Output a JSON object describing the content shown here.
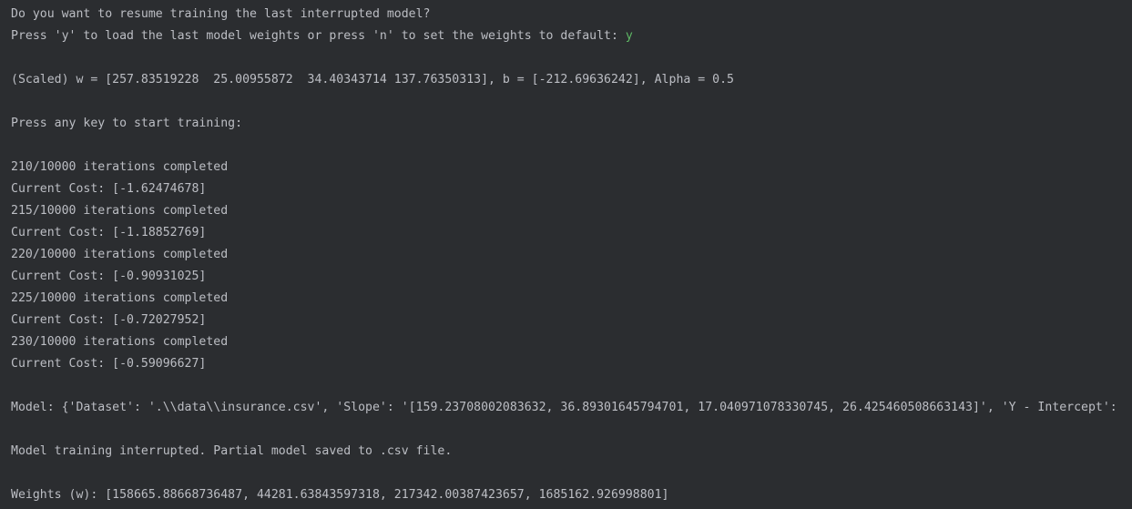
{
  "console": {
    "prompt_resume": "Do you want to resume training the last interrupted model?",
    "prompt_load": "Press 'y' to load the last model weights or press 'n' to set the weights to default: ",
    "user_answer": "y",
    "scaled_params": "(Scaled) w = [257.83519228  25.00955872  34.40343714 137.76350313], b = [-212.69636242], Alpha = 0.5",
    "press_any_key": "Press any key to start training:",
    "log": [
      "210/10000 iterations completed",
      "Current Cost: [-1.62474678]",
      "215/10000 iterations completed",
      "Current Cost: [-1.18852769]",
      "220/10000 iterations completed",
      "Current Cost: [-0.90931025]",
      "225/10000 iterations completed",
      "Current Cost: [-0.72027952]",
      "230/10000 iterations completed",
      "Current Cost: [-0.59096627]"
    ],
    "model_line": "Model: {'Dataset': '.\\\\data\\\\insurance.csv', 'Slope': '[159.23708002083632, 36.89301645794701, 17.040971078330745, 26.425460508663143]', 'Y - Intercept':",
    "interrupted": "Model training interrupted. Partial model saved to .csv file.",
    "weights": "Weights (w): [158665.88668736487, 44281.63843597318, 217342.00387423657, 1685162.926998801]"
  },
  "colors": {
    "background": "#2b2d30",
    "text": "#bcbec4",
    "input_answer": "#5fb865"
  }
}
